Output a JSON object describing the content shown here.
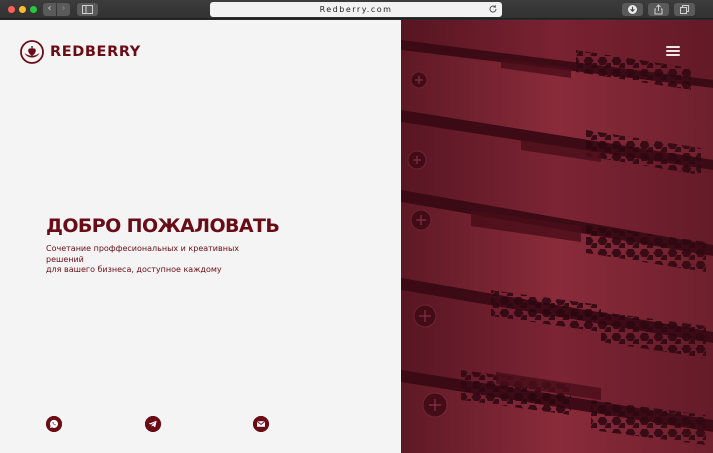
{
  "browser": {
    "url": "Redberry.com"
  },
  "brand": {
    "name": "REDBERRY",
    "color": "#6a0c16"
  },
  "hero": {
    "title": "ДОБРО ПОЖАЛОВАТЬ",
    "subtitle_line1": "Сочетание проффесиональных и креативных решений",
    "subtitle_line2": "для вашего бизнеса, доступное каждому"
  },
  "social": [
    {
      "icon": "whatsapp-icon"
    },
    {
      "icon": "telegram-icon"
    },
    {
      "icon": "mail-icon"
    }
  ],
  "menu": {
    "icon": "hamburger-menu-icon"
  }
}
